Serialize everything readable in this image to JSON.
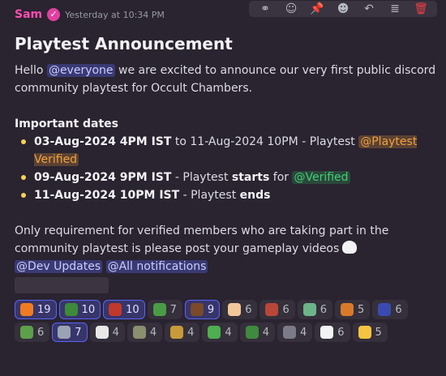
{
  "message": {
    "author": "Sam",
    "timestamp": "Yesterday at 10:34 PM",
    "title": "Playtest  Announcement",
    "intro_pre": "Hello ",
    "intro_mention": "@everyone",
    "intro_post": " we are excited to announce our very first public discord community playtest for Occult Chambers.",
    "important_heading": "Important dates",
    "dates": [
      {
        "bold": "03-Aug-2024 4PM IST",
        "text": "  to 11-Aug-2024 10PM - Playtest ",
        "mention": "@Playtest Verified"
      },
      {
        "bold": "09-Aug-2024 9PM IST",
        "text": "  - Playtest ",
        "bold2": "starts",
        "text2": " for ",
        "mention": "@Verified"
      },
      {
        "bold": "11-Aug-2024 10PM IST",
        "text": " - Playtest ",
        "bold2": "ends"
      }
    ],
    "requirement": "Only requirement for verified members who are taking part in the community playtest is please post your gameplay videos",
    "mentions_bottom": [
      "@Dev Updates",
      "@All notifications"
    ]
  },
  "toolbar": {
    "icons": [
      "link-icon",
      "add-reaction-icon",
      "pin-icon",
      "emoji-icon",
      "reply-icon",
      "threads-icon",
      "delete-icon"
    ],
    "glyphs": [
      "⚭",
      "☺",
      "📌",
      "☻",
      "↶",
      "≣",
      "🗑"
    ]
  },
  "reactions": [
    {
      "emoji": "fire-emoji",
      "glyph": "🔥",
      "color": "#f07b22",
      "count": "19",
      "active": true
    },
    {
      "emoji": "frog-emoji",
      "glyph": "●",
      "color": "#3d8a3a",
      "count": "10",
      "active": true
    },
    {
      "emoji": "goblin-emoji",
      "glyph": "●",
      "color": "#c0392b",
      "count": "10",
      "active": true
    },
    {
      "emoji": "frog2-emoji",
      "glyph": "●",
      "color": "#4a9b46",
      "count": "7",
      "active": false
    },
    {
      "emoji": "portrait-emoji",
      "glyph": "●",
      "color": "#7a4a2a",
      "count": "9",
      "active": true
    },
    {
      "emoji": "cat-emoji",
      "glyph": "●",
      "color": "#f2c79a",
      "count": "6",
      "active": false
    },
    {
      "emoji": "brick-emoji",
      "glyph": "●",
      "color": "#b8473a",
      "count": "6",
      "active": false
    },
    {
      "emoji": "ghost-emoji",
      "glyph": "●",
      "color": "#6cb58a",
      "count": "6",
      "active": false
    },
    {
      "emoji": "pixel-emoji",
      "glyph": "●",
      "color": "#d87a2a",
      "count": "5",
      "active": false
    },
    {
      "emoji": "wizard-emoji",
      "glyph": "●",
      "color": "#3a4ab0",
      "count": "6",
      "active": false
    },
    {
      "emoji": "frog3-emoji",
      "glyph": "●",
      "color": "#5da04a",
      "count": "6",
      "active": false
    },
    {
      "emoji": "knight-emoji",
      "glyph": "●",
      "color": "#9aa3b5",
      "count": "7",
      "active": true
    },
    {
      "emoji": "skull-emoji",
      "glyph": "●",
      "color": "#e8e8e8",
      "count": "4",
      "active": false
    },
    {
      "emoji": "warrior-emoji",
      "glyph": "●",
      "color": "#8a8f70",
      "count": "4",
      "active": false
    },
    {
      "emoji": "chest-emoji",
      "glyph": "●",
      "color": "#c89a3a",
      "count": "4",
      "active": false
    },
    {
      "emoji": "frog4-emoji",
      "glyph": "●",
      "color": "#4fae4f",
      "count": "4",
      "active": false
    },
    {
      "emoji": "tree-emoji",
      "glyph": "●",
      "color": "#3f8a3f",
      "count": "4",
      "active": false
    },
    {
      "emoji": "castle-emoji",
      "glyph": "●",
      "color": "#7a7a88",
      "count": "4",
      "active": false
    },
    {
      "emoji": "eyes-emoji",
      "glyph": "👀",
      "color": "#f2f3f5",
      "count": "6",
      "active": false
    },
    {
      "emoji": "star-emoji",
      "glyph": "★",
      "color": "#f5c542",
      "count": "5",
      "active": false
    }
  ]
}
